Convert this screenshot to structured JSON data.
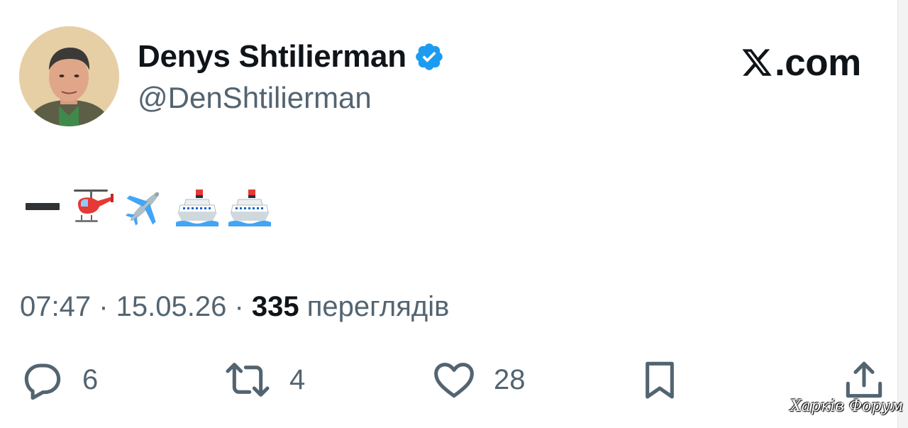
{
  "author": {
    "display_name": "Denys Shtilierman",
    "handle": "@DenShtilierman",
    "verified": true
  },
  "brand": {
    "text": ".com",
    "icon": "x-logo-icon"
  },
  "tweet": {
    "emojis": [
      "helicopter",
      "airplane",
      "ship",
      "ship"
    ]
  },
  "meta": {
    "time": "07:47",
    "separator": " · ",
    "date": "15.05.26",
    "views_count": "335",
    "views_label": " переглядів"
  },
  "actions": {
    "replies": {
      "icon": "reply-icon",
      "count": "6"
    },
    "reposts": {
      "icon": "repost-icon",
      "count": "4"
    },
    "likes": {
      "icon": "heart-icon",
      "count": "28"
    },
    "bookmark": {
      "icon": "bookmark-icon"
    },
    "share": {
      "icon": "share-icon"
    }
  },
  "watermark": "Харків Форум",
  "colors": {
    "text": "#0f1419",
    "secondary": "#536471",
    "verified": "#1d9bf0"
  }
}
